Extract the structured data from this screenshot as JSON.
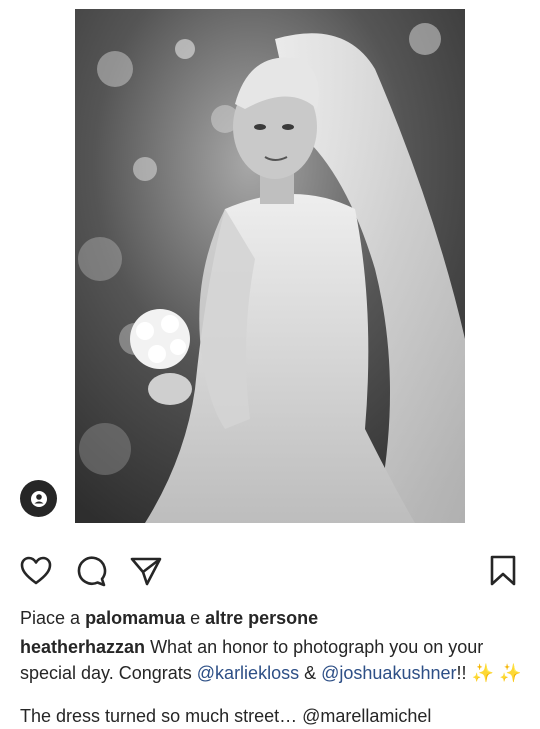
{
  "post": {
    "likes_prefix": "Piace a",
    "liked_by": "palomamua",
    "likes_conj": "e",
    "others": "altre persone",
    "caption_user": "heatherhazzan",
    "caption_text_1": "What an honor to photograph you on your special day. Congrats",
    "mention_1": "@karliekloss",
    "caption_amp": "&",
    "mention_2": "@joshuakushner",
    "caption_end": "!!",
    "sparkle_1": "✨",
    "sparkle_2": "✨",
    "next_line": "The dress turned so much street… @marellamichel"
  },
  "icons": {
    "tag": "user-tag-icon",
    "like": "heart-icon",
    "comment": "comment-icon",
    "share": "send-icon",
    "save": "bookmark-icon"
  },
  "colors": {
    "text": "#262626",
    "mention": "#2d4f86",
    "sparkle": "#f2c94c"
  }
}
